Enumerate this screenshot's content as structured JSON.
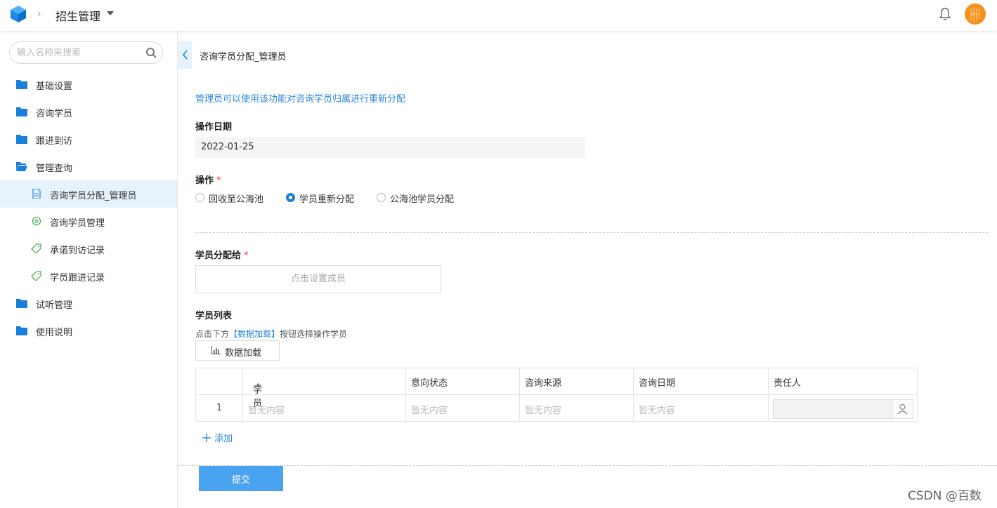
{
  "header": {
    "breadcrumb_sep": "›",
    "app_title": "招生管理"
  },
  "sidebar": {
    "search_placeholder": "输入名称来搜索",
    "items": [
      {
        "label": "基础设置",
        "icon": "folder-icon"
      },
      {
        "label": "咨询学员",
        "icon": "folder-icon"
      },
      {
        "label": "跟进到访",
        "icon": "folder-icon"
      },
      {
        "label": "管理查询",
        "icon": "folder-open-icon"
      },
      {
        "label": "咨询学员分配_管理员",
        "icon": "document-icon"
      },
      {
        "label": "咨询学员管理",
        "icon": "gear-icon"
      },
      {
        "label": "承诺到访记录",
        "icon": "tag-icon"
      },
      {
        "label": "学员跟进记录",
        "icon": "tag-icon"
      },
      {
        "label": "试听管理",
        "icon": "folder-icon"
      },
      {
        "label": "使用说明",
        "icon": "folder-icon"
      }
    ]
  },
  "main": {
    "page_title": "咨询学员分配_管理员",
    "hint": "管理员可以使用该功能对咨询学员归属进行重新分配",
    "date_label": "操作日期",
    "date_value": "2022-01-25",
    "op_label": "操作",
    "required_mark": "*",
    "radios": [
      {
        "label": "回收至公海池",
        "checked": false
      },
      {
        "label": "学员重新分配",
        "checked": true
      },
      {
        "label": "公海池学员分配",
        "checked": false
      }
    ],
    "assign_label": "学员分配给",
    "member_button": "点击设置成员",
    "list_label": "学员列表",
    "tip_prefix": "点击下方",
    "tip_highlight": "【数据加载】",
    "tip_suffix": "按钮选择操作学员",
    "load_button": "数据加载",
    "table": {
      "headers": [
        "学员",
        "意向状态",
        "咨询来源",
        "咨询日期",
        "责任人"
      ],
      "rows": [
        {
          "index": "1",
          "cells": [
            "暂无内容",
            "暂无内容",
            "暂无内容",
            "暂无内容"
          ]
        }
      ]
    },
    "add_label": "添加",
    "submit_button": "提交"
  },
  "watermark": "CSDN @百数",
  "colors": {
    "accent": "#1a7fd9",
    "link": "#2b86d9",
    "submit": "#4aa3ef",
    "active_bg": "#e6f2fc",
    "avatar": "#f5901f"
  }
}
